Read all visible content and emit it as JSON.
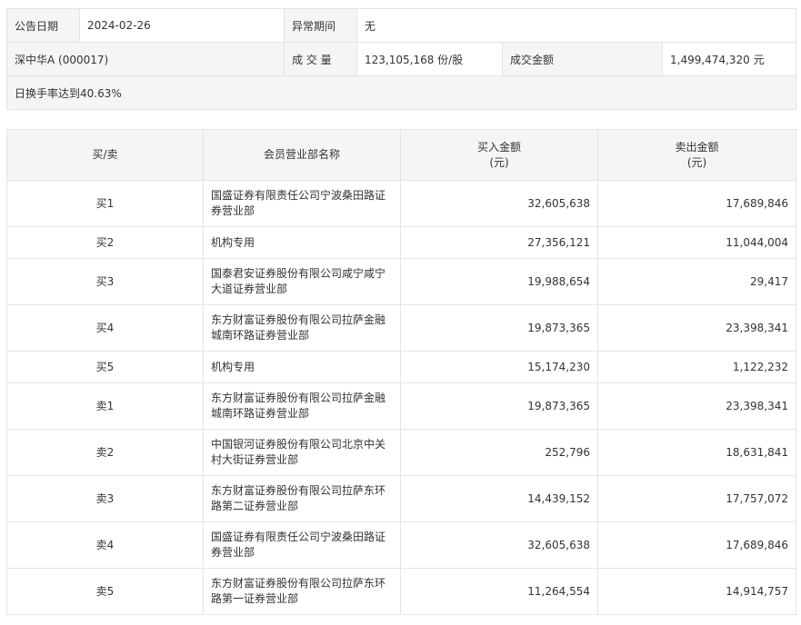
{
  "info": {
    "date_label": "公告日期",
    "date_value": "2024-02-26",
    "abnormal_label": "异常期间",
    "abnormal_value": "无",
    "stock_name": "深中华A (000017)",
    "volume_label": "成 交 量",
    "volume_value": "123,105,168 份/股",
    "amount_label": "成交金额",
    "amount_value": "1,499,474,320 元",
    "turnover_note": "日换手率达到40.63%"
  },
  "table": {
    "headers": {
      "side": "买/卖",
      "dept": "会员营业部名称",
      "buy_line1": "买入金额",
      "buy_line2": "(元)",
      "sell_line1": "卖出金额",
      "sell_line2": "(元)"
    },
    "rows": [
      {
        "side": "买1",
        "dept": "国盛证券有限责任公司宁波桑田路证券营业部",
        "buy": "32,605,638",
        "sell": "17,689,846"
      },
      {
        "side": "买2",
        "dept": "机构专用",
        "buy": "27,356,121",
        "sell": "11,044,004"
      },
      {
        "side": "买3",
        "dept": "国泰君安证券股份有限公司咸宁咸宁大道证券营业部",
        "buy": "19,988,654",
        "sell": "29,417"
      },
      {
        "side": "买4",
        "dept": "东方财富证券股份有限公司拉萨金融城南环路证券营业部",
        "buy": "19,873,365",
        "sell": "23,398,341"
      },
      {
        "side": "买5",
        "dept": "机构专用",
        "buy": "15,174,230",
        "sell": "1,122,232"
      },
      {
        "side": "卖1",
        "dept": "东方财富证券股份有限公司拉萨金融城南环路证券营业部",
        "buy": "19,873,365",
        "sell": "23,398,341"
      },
      {
        "side": "卖2",
        "dept": "中国银河证券股份有限公司北京中关村大街证券营业部",
        "buy": "252,796",
        "sell": "18,631,841"
      },
      {
        "side": "卖3",
        "dept": "东方财富证券股份有限公司拉萨东环路第二证券营业部",
        "buy": "14,439,152",
        "sell": "17,757,072"
      },
      {
        "side": "卖4",
        "dept": "国盛证券有限责任公司宁波桑田路证券营业部",
        "buy": "32,605,638",
        "sell": "17,689,846"
      },
      {
        "side": "卖5",
        "dept": "东方财富证券股份有限公司拉萨东环路第一证券营业部",
        "buy": "11,264,554",
        "sell": "14,914,757"
      }
    ]
  }
}
